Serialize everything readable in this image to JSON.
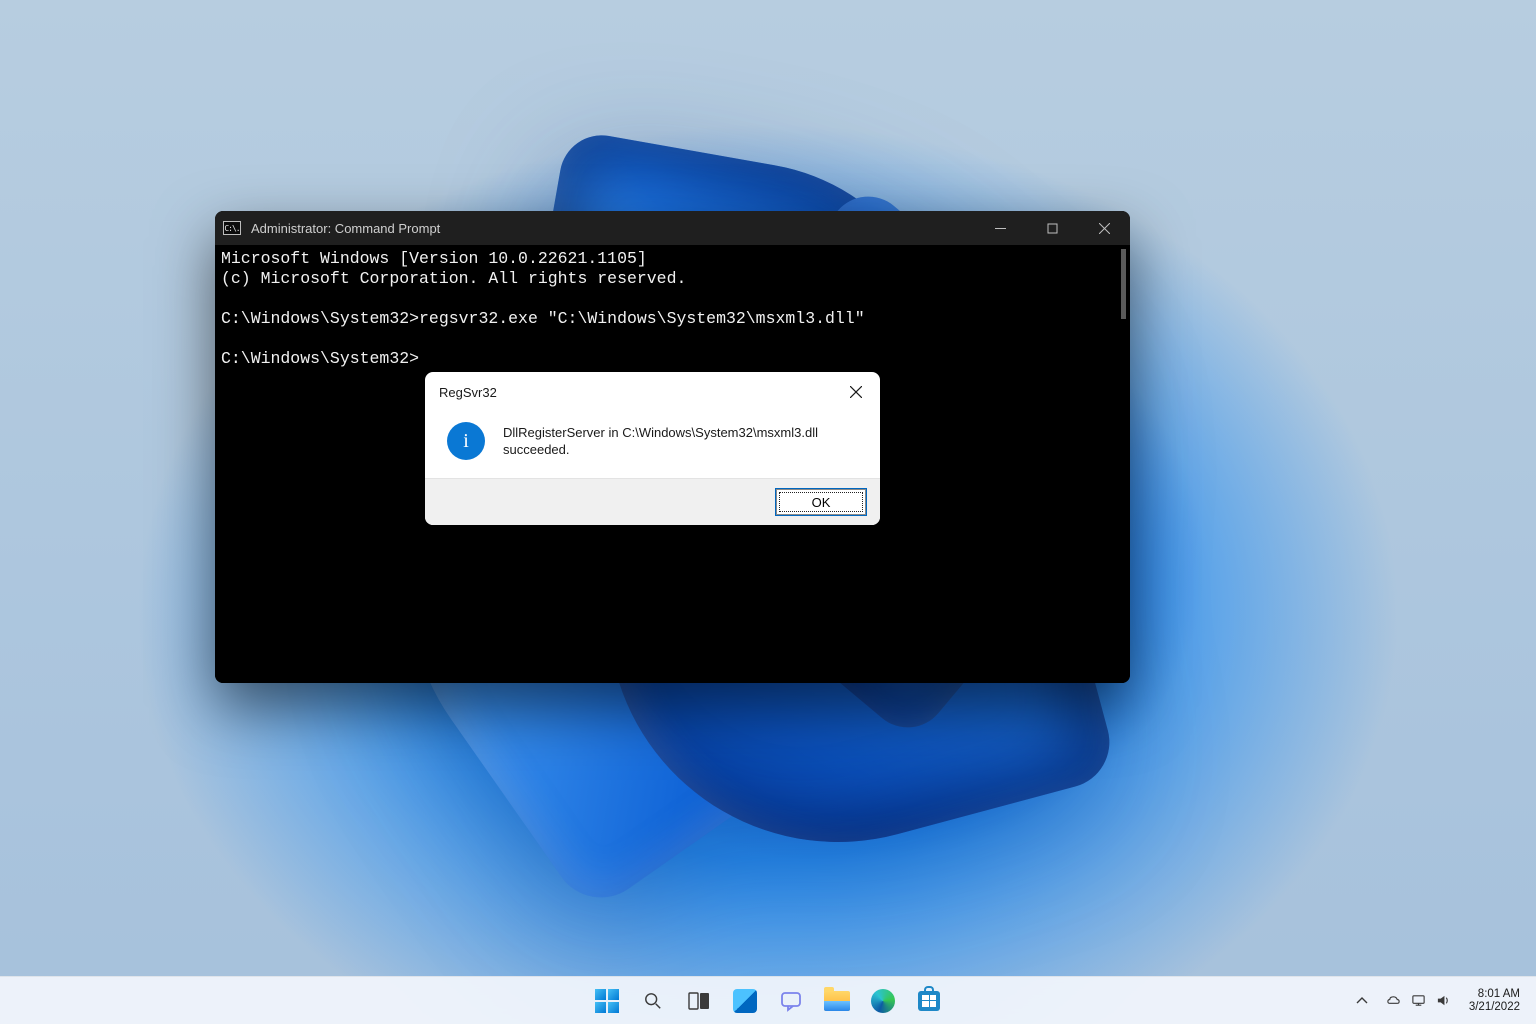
{
  "cmd": {
    "title": "Administrator: Command Prompt",
    "icon_text": "C:\\.",
    "lines": {
      "l1": "Microsoft Windows [Version 10.0.22621.1105]",
      "l2": "(c) Microsoft Corporation. All rights reserved.",
      "l3": "",
      "l4": "C:\\Windows\\System32>regsvr32.exe \"C:\\Windows\\System32\\msxml3.dll\"",
      "l5": "",
      "l6": "C:\\Windows\\System32>"
    }
  },
  "dialog": {
    "title": "RegSvr32",
    "message": "DllRegisterServer in C:\\Windows\\System32\\msxml3.dll succeeded.",
    "ok_label": "OK"
  },
  "taskbar": {
    "time": "8:01 AM",
    "date": "3/21/2022"
  }
}
